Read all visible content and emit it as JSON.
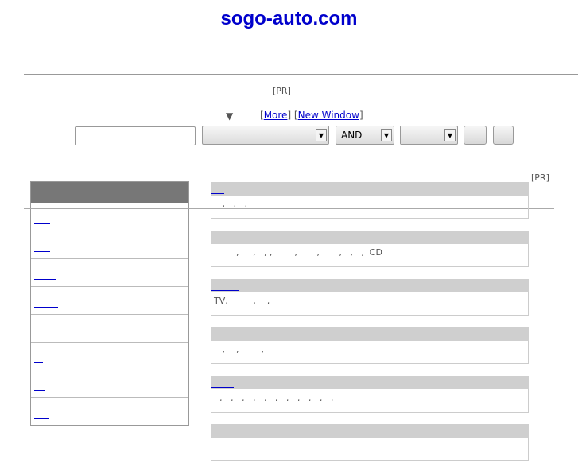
{
  "site_title": "sogo-auto.com",
  "pr_top": "[PR]",
  "pr_right": "[PR]",
  "search": {
    "triangle": "▼",
    "more_label": "More",
    "new_window_label": "New Window",
    "input_value": "",
    "select_category": "",
    "select_operator": "AND",
    "select_third": ""
  },
  "sidebar": {
    "items": [
      {
        "link_width": 20
      },
      {
        "link_width": 20
      },
      {
        "link_width": 27
      },
      {
        "link_width": 30
      },
      {
        "link_width": 22
      },
      {
        "link_width": 11
      },
      {
        "link_width": 14
      },
      {
        "link_width": 19
      }
    ]
  },
  "categories": [
    {
      "desc": "   ,   ,   ,"
    },
    {
      "desc": "        ,     ,   , ,        ,       ,       ,   ,   ,  CD"
    },
    {
      "desc": "TV,         ,    ,"
    },
    {
      "desc": "   ,    ,        ,"
    },
    {
      "desc": "  ,   ,   ,   ,   ,   ,   ,   ,   ,   ,   ,"
    },
    {
      "desc": ""
    }
  ]
}
